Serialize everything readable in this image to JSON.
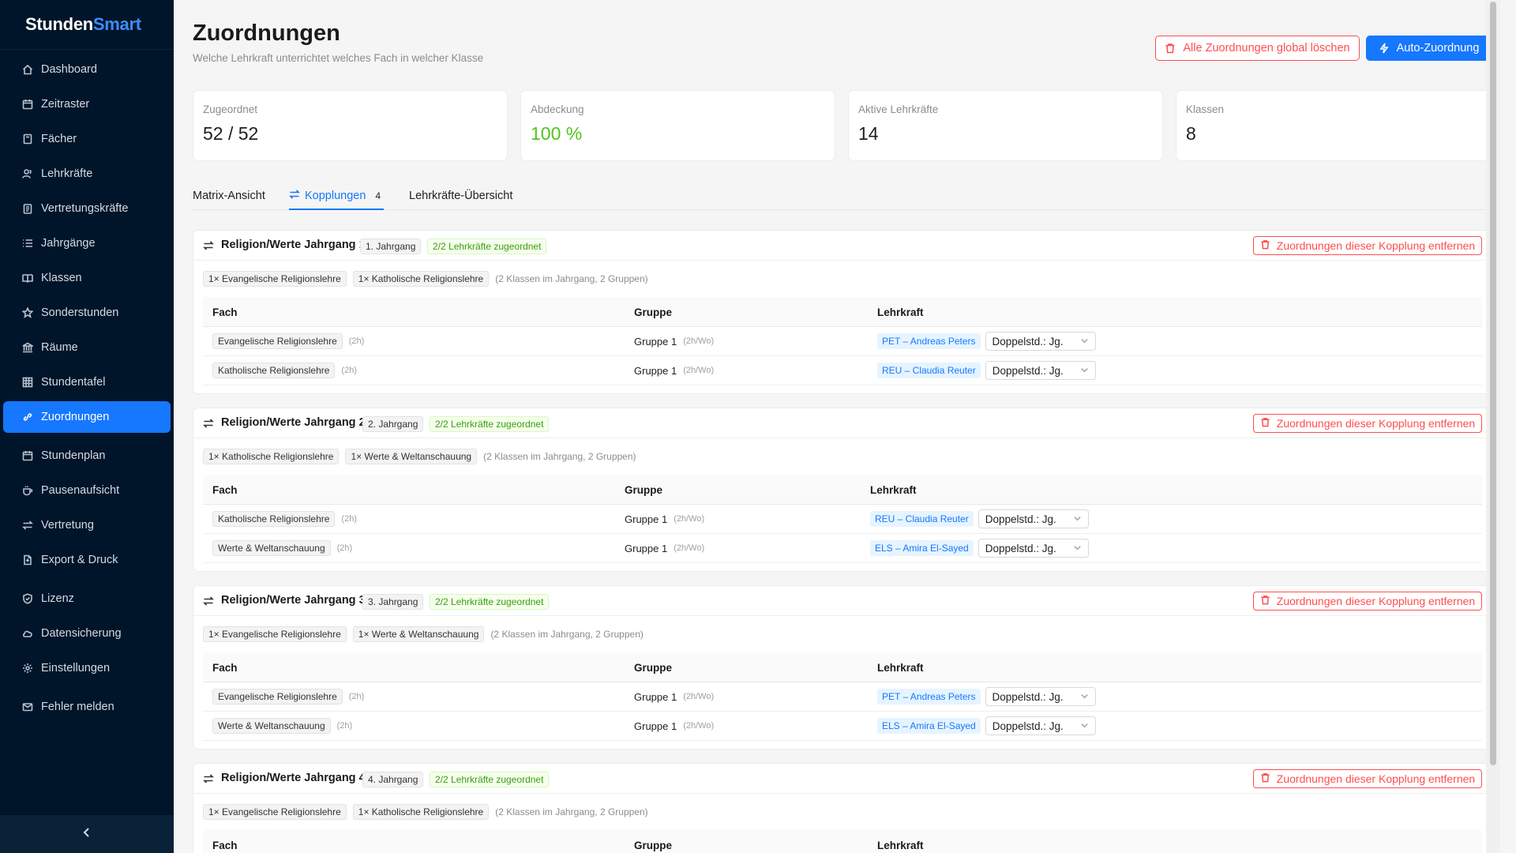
{
  "app": {
    "brand_a": "Stunden",
    "brand_b": "Smart"
  },
  "nav": [
    {
      "label": "Dashboard",
      "icon": "home-icon"
    },
    {
      "label": "Zeitraster",
      "icon": "calendar-icon"
    },
    {
      "label": "Fächer",
      "icon": "book-icon"
    },
    {
      "label": "Lehrkräfte",
      "icon": "users-icon"
    },
    {
      "label": "Vertretungskräfte",
      "icon": "clipboard-icon"
    },
    {
      "label": "Jahrgänge",
      "icon": "list-icon"
    },
    {
      "label": "Klassen",
      "icon": "book-open-icon"
    },
    {
      "label": "Sonderstunden",
      "icon": "star-icon"
    },
    {
      "label": "Räume",
      "icon": "bank-icon"
    },
    {
      "label": "Stundentafel",
      "icon": "table-icon"
    },
    {
      "label": "Zuordnungen",
      "icon": "link-icon"
    },
    {
      "label": "Stundenplan",
      "icon": "calendar-icon"
    },
    {
      "label": "Pausenaufsicht",
      "icon": "coffee-icon"
    },
    {
      "label": "Vertretung",
      "icon": "swap-icon"
    },
    {
      "label": "Export & Druck",
      "icon": "file-export-icon"
    },
    {
      "label": "Lizenz",
      "icon": "shield-icon"
    },
    {
      "label": "Datensicherung",
      "icon": "cloud-icon"
    },
    {
      "label": "Einstellungen",
      "icon": "gear-icon"
    },
    {
      "label": "Fehler melden",
      "icon": "mail-icon"
    }
  ],
  "header": {
    "title": "Zuordnungen",
    "subtitle": "Welche Lehrkraft unterrichtet welches Fach in welcher Klasse",
    "delete_all_label": "Alle Zuordnungen global löschen",
    "auto_label": "Auto-Zuordnung"
  },
  "stats": [
    {
      "label": "Zugeordnet",
      "value": "52 / 52"
    },
    {
      "label": "Abdeckung",
      "value": "100 %"
    },
    {
      "label": "Aktive Lehrkräfte",
      "value": "14"
    },
    {
      "label": "Klassen",
      "value": "8"
    }
  ],
  "tabs": [
    {
      "label": "Matrix-Ansicht"
    },
    {
      "label": "Kopplungen",
      "count": "4"
    },
    {
      "label": "Lehrkräfte-Übersicht"
    }
  ],
  "table_headers": {
    "fach": "Fach",
    "gruppe": "Gruppe",
    "lehrkraft": "Lehrkraft"
  },
  "remove_label": "Zuordnungen dieser Kopplung entfernen",
  "colors": {
    "primary": "#1677ff",
    "danger": "#ff4d4f",
    "success": "#52c41a",
    "sidebar": "#001529"
  },
  "couplings": [
    {
      "title": "Religion/Werte Jahrgang 1",
      "grade": "1. Jahrgang",
      "assigned": "2/2 Lehrkräfte zugeordnet",
      "subjects": [
        "1× Evangelische Religionslehre",
        "1× Katholische Religionslehre"
      ],
      "note": "(2 Klassen im Jahrgang, 2 Gruppen)",
      "rows": [
        {
          "fach": "Evangelische Religionslehre",
          "fach_hours": "(2h)",
          "gruppe": "Gruppe 1",
          "gruppe_hours": "(2h/Wo)",
          "teacher": "PET – Andreas Peters",
          "mode": "Doppelstd.: Jg."
        },
        {
          "fach": "Katholische Religionslehre",
          "fach_hours": "(2h)",
          "gruppe": "Gruppe 1",
          "gruppe_hours": "(2h/Wo)",
          "teacher": "REU – Claudia Reuter",
          "mode": "Doppelstd.: Jg."
        }
      ]
    },
    {
      "title": "Religion/Werte Jahrgang 2",
      "grade": "2. Jahrgang",
      "assigned": "2/2 Lehrkräfte zugeordnet",
      "subjects": [
        "1× Katholische Religionslehre",
        "1× Werte & Weltanschauung"
      ],
      "note": "(2 Klassen im Jahrgang, 2 Gruppen)",
      "rows": [
        {
          "fach": "Katholische Religionslehre",
          "fach_hours": "(2h)",
          "gruppe": "Gruppe 1",
          "gruppe_hours": "(2h/Wo)",
          "teacher": "REU – Claudia Reuter",
          "mode": "Doppelstd.: Jg."
        },
        {
          "fach": "Werte & Weltanschauung",
          "fach_hours": "(2h)",
          "gruppe": "Gruppe 1",
          "gruppe_hours": "(2h/Wo)",
          "teacher": "ELS – Amira El-Sayed",
          "mode": "Doppelstd.: Jg."
        }
      ]
    },
    {
      "title": "Religion/Werte Jahrgang 3",
      "grade": "3. Jahrgang",
      "assigned": "2/2 Lehrkräfte zugeordnet",
      "subjects": [
        "1× Evangelische Religionslehre",
        "1× Werte & Weltanschauung"
      ],
      "note": "(2 Klassen im Jahrgang, 2 Gruppen)",
      "rows": [
        {
          "fach": "Evangelische Religionslehre",
          "fach_hours": "(2h)",
          "gruppe": "Gruppe 1",
          "gruppe_hours": "(2h/Wo)",
          "teacher": "PET – Andreas Peters",
          "mode": "Doppelstd.: Jg."
        },
        {
          "fach": "Werte & Weltanschauung",
          "fach_hours": "(2h)",
          "gruppe": "Gruppe 1",
          "gruppe_hours": "(2h/Wo)",
          "teacher": "ELS – Amira El-Sayed",
          "mode": "Doppelstd.: Jg."
        }
      ]
    },
    {
      "title": "Religion/Werte Jahrgang 4",
      "grade": "4. Jahrgang",
      "assigned": "2/2 Lehrkräfte zugeordnet",
      "subjects": [
        "1× Evangelische Religionslehre",
        "1× Katholische Religionslehre"
      ],
      "note": "(2 Klassen im Jahrgang, 2 Gruppen)",
      "rows": []
    }
  ]
}
